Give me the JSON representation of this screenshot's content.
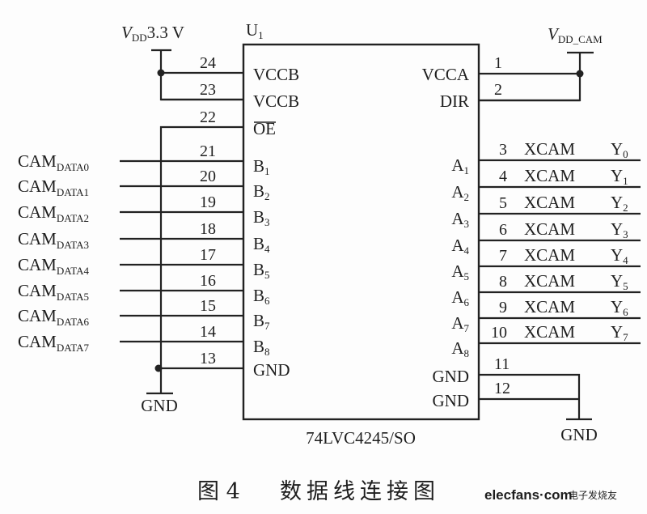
{
  "figure": {
    "chip_ref": {
      "base": "U",
      "sub": "1"
    },
    "chip_part": "74LVC4245/SO",
    "vdd_left": {
      "v": "V",
      "sub": "DD",
      "value": "3.3 V"
    },
    "vdd_right": {
      "v": "V",
      "sub": "DD_CAM"
    },
    "gnd_left": "GND",
    "gnd_right": "GND",
    "left_pins": [
      {
        "num": "24",
        "name": "VCCB",
        "sub": ""
      },
      {
        "num": "23",
        "name": "VCCB",
        "sub": ""
      },
      {
        "num": "22",
        "name": "OE",
        "sub": "",
        "overbar": true
      },
      {
        "num": "21",
        "name": "B",
        "sub": "1",
        "signal": "CAM",
        "signal_sub": "DATA0"
      },
      {
        "num": "20",
        "name": "B",
        "sub": "2",
        "signal": "CAM",
        "signal_sub": "DATA1"
      },
      {
        "num": "19",
        "name": "B",
        "sub": "3",
        "signal": "CAM",
        "signal_sub": "DATA2"
      },
      {
        "num": "18",
        "name": "B",
        "sub": "4",
        "signal": "CAM",
        "signal_sub": "DATA3"
      },
      {
        "num": "17",
        "name": "B",
        "sub": "5",
        "signal": "CAM",
        "signal_sub": "DATA4"
      },
      {
        "num": "16",
        "name": "B",
        "sub": "6",
        "signal": "CAM",
        "signal_sub": "DATA5"
      },
      {
        "num": "15",
        "name": "B",
        "sub": "7",
        "signal": "CAM",
        "signal_sub": "DATA6"
      },
      {
        "num": "14",
        "name": "B",
        "sub": "8",
        "signal": "CAM",
        "signal_sub": "DATA7"
      },
      {
        "num": "13",
        "name": "GND",
        "sub": ""
      }
    ],
    "right_pins": [
      {
        "num": "1",
        "name": "VCCA",
        "sub": ""
      },
      {
        "num": "2",
        "name": "DIR",
        "sub": ""
      },
      {
        "num": "3",
        "name": "A",
        "sub": "1",
        "signal": "XCAM",
        "signal_y": "Y",
        "signal_sub": "0"
      },
      {
        "num": "4",
        "name": "A",
        "sub": "2",
        "signal": "XCAM",
        "signal_y": "Y",
        "signal_sub": "1"
      },
      {
        "num": "5",
        "name": "A",
        "sub": "3",
        "signal": "XCAM",
        "signal_y": "Y",
        "signal_sub": "2"
      },
      {
        "num": "6",
        "name": "A",
        "sub": "4",
        "signal": "XCAM",
        "signal_y": "Y",
        "signal_sub": "3"
      },
      {
        "num": "7",
        "name": "A",
        "sub": "5",
        "signal": "XCAM",
        "signal_y": "Y",
        "signal_sub": "4"
      },
      {
        "num": "8",
        "name": "A",
        "sub": "6",
        "signal": "XCAM",
        "signal_y": "Y",
        "signal_sub": "5"
      },
      {
        "num": "9",
        "name": "A",
        "sub": "7",
        "signal": "XCAM",
        "signal_y": "Y",
        "signal_sub": "6"
      },
      {
        "num": "10",
        "name": "A",
        "sub": "8",
        "signal": "XCAM",
        "signal_y": "Y",
        "signal_sub": "7"
      },
      {
        "num": "11",
        "name": "GND",
        "sub": ""
      },
      {
        "num": "12",
        "name": "GND",
        "sub": ""
      }
    ]
  },
  "caption": {
    "label": "图 4",
    "title": "数据线连接图"
  },
  "watermark": {
    "brand": "elecfans·com",
    "brand_color": "#d4262b",
    "cn": "电子发烧友"
  }
}
